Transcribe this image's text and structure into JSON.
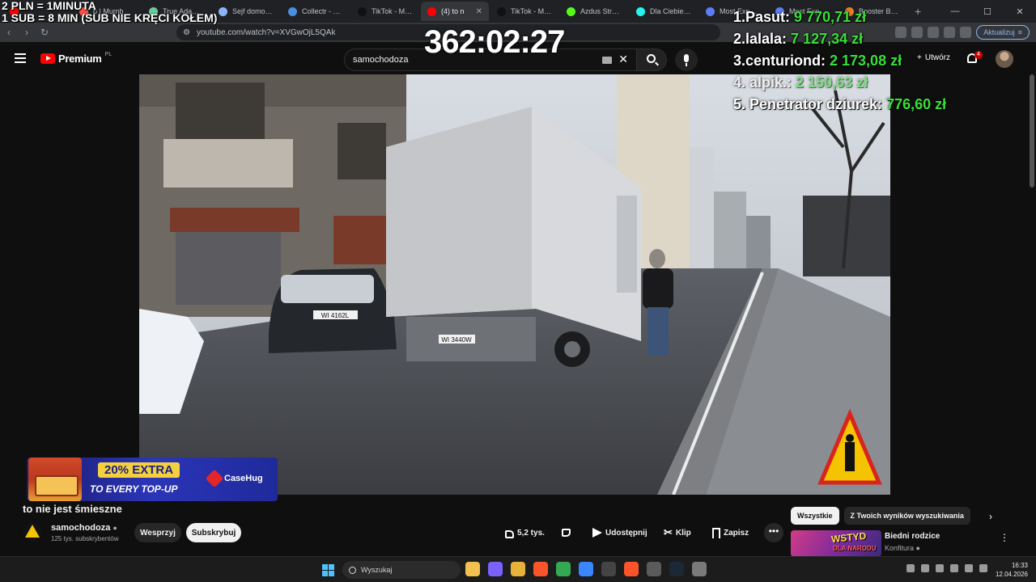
{
  "browser": {
    "tabs": [
      {
        "title": "",
        "color": "#ff0000",
        "active": false
      },
      {
        "title": "b | Mumb",
        "color": "#ff4e45",
        "active": false
      },
      {
        "title": "True Adam Cha",
        "color": "#6c9",
        "active": false
      },
      {
        "title": "Sejf domowy h",
        "color": "#8ab4f8",
        "active": false
      },
      {
        "title": "Collectr - Track",
        "color": "#4a90e2",
        "active": false
      },
      {
        "title": "TikTok - Make",
        "color": "#111111",
        "active": false
      },
      {
        "title": "(4) to n",
        "color": "#ff0000",
        "active": true
      },
      {
        "title": "TikTok - Make",
        "color": "#111111",
        "active": false
      },
      {
        "title": "Azdus Stream",
        "color": "#53fc18",
        "active": false
      },
      {
        "title": "Dla Ciebie wsz",
        "color": "#25f4ee",
        "active": false
      },
      {
        "title": "Most Expensiv",
        "color": "#5c7cfa",
        "active": false
      },
      {
        "title": "Most Expensiv",
        "color": "#5c7cfa",
        "active": false
      },
      {
        "title": "Booster Box [V",
        "color": "#e67e22",
        "active": false
      }
    ],
    "url": "youtube.com/watch?v=XVGwOjL5QAk",
    "update_label": "Aktualizuj"
  },
  "overlay": {
    "rate_line1": "2 PLN =  1MINUTA",
    "rate_line2": "1 SUB = 8 MIN (SUB NIE KRĘCI KOŁEM)",
    "timer": "362:02:27",
    "leaderboard": [
      {
        "name": "1.Pasut: ",
        "amount": "9 770,71 zł"
      },
      {
        "name": "2.lalala: ",
        "amount": "7 127,34 zł"
      },
      {
        "name": "3.centuriond: ",
        "amount": "2 173,08 zł"
      },
      {
        "name": "4. alpik.: ",
        "amount": "2 150,63 zł"
      },
      {
        "name": "5. Penetrator dziurek: ",
        "amount": "776,60 zł"
      }
    ],
    "ad": {
      "line1": "20% EXTRA",
      "line2": "TO EVERY TOP-UP",
      "brand": "CaseHug"
    }
  },
  "youtube": {
    "logo_text": "Premium",
    "logo_country": "PL",
    "search_value": "samochodoza",
    "create_label": "Utwórz",
    "notification_count": "4",
    "video": {
      "title": "to nie jest śmieszne",
      "channel": "samochodoza",
      "subscribers": "125 tys. subskrybentów",
      "support_label": "Wesprzyj",
      "subscribe_label": "Subskrybuj",
      "likes": "5,2 tys.",
      "share_label": "Udostępnij",
      "clip_label": "Klip",
      "save_label": "Zapisz",
      "plate_car": "WI 4162L",
      "plate_truck": "WI 3440W"
    },
    "sidebar": {
      "chips": [
        "Wszystkie",
        "Z Twoich wyników wyszukiwania"
      ],
      "active_chip": 0,
      "recommendation": {
        "title": "Biedni rodzice",
        "channel": "Konfitura",
        "thumb_text1": "WSTYD",
        "thumb_text2": "DLA NARODU"
      }
    }
  },
  "taskbar": {
    "search_placeholder": "Wyszukaj",
    "time": "16:33",
    "date": "12.04.2026",
    "apps": [
      {
        "name": "file-explorer-icon",
        "color": "#f2c14e"
      },
      {
        "name": "copilot-icon",
        "color": "#7b61ff"
      },
      {
        "name": "folder-icon",
        "color": "#e8b23a"
      },
      {
        "name": "brave-icon",
        "color": "#fb542b"
      },
      {
        "name": "chrome-icon",
        "color": "#34a853"
      },
      {
        "name": "store-icon",
        "color": "#3a86ff"
      },
      {
        "name": "obs-icon",
        "color": "#444444"
      },
      {
        "name": "brave-alt-icon",
        "color": "#fb542b"
      },
      {
        "name": "calculator-icon",
        "color": "#5b5b5b"
      },
      {
        "name": "steam-icon",
        "color": "#1b2838"
      },
      {
        "name": "settings-icon",
        "color": "#7a7a7a"
      }
    ]
  }
}
